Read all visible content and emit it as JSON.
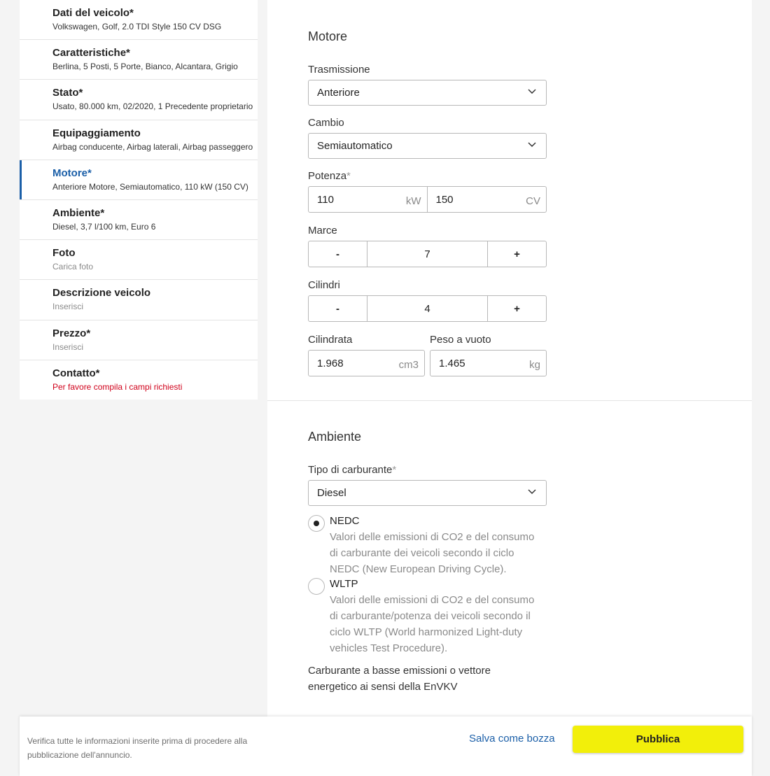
{
  "sidebar": {
    "items": [
      {
        "title": "Dati del veicolo*",
        "sub": "Volkswagen, Golf, 2.0 TDI Style 150 CV DSG"
      },
      {
        "title": "Caratteristiche*",
        "sub": "Berlina, 5 Posti, 5 Porte, Bianco, Alcantara, Grigio"
      },
      {
        "title": "Stato*",
        "sub": "Usato, 80.000 km, 02/2020, 1 Precedente proprietario"
      },
      {
        "title": "Equipaggiamento",
        "sub": "Airbag conducente, Airbag laterali, Airbag passeggero"
      },
      {
        "title": "Motore*",
        "sub": "Anteriore Motore, Semiautomatico, 110 kW (150 CV)"
      },
      {
        "title": "Ambiente*",
        "sub": "Diesel, 3,7 l/100 km, Euro 6"
      },
      {
        "title": "Foto",
        "sub": "Carica foto"
      },
      {
        "title": "Descrizione veicolo",
        "sub": "Inserisci"
      },
      {
        "title": "Prezzo*",
        "sub": "Inserisci"
      },
      {
        "title": "Contatto*",
        "sub": "Per favore compila i campi richiesti"
      }
    ]
  },
  "motore": {
    "title": "Motore",
    "trasmissione_label": "Trasmissione",
    "trasmissione_value": "Anteriore",
    "cambio_label": "Cambio",
    "cambio_value": "Semiautomatico",
    "potenza_label": "Potenza",
    "required_mark": "*",
    "potenza_kw": "110",
    "potenza_kw_unit": "kW",
    "potenza_cv": "150",
    "potenza_cv_unit": "CV",
    "marce_label": "Marce",
    "marce_value": "7",
    "cilindri_label": "Cilindri",
    "cilindri_value": "4",
    "minus": "-",
    "plus": "+",
    "cilindrata_label": "Cilindrata",
    "cilindrata_value": "1.968",
    "cilindrata_unit": "cm3",
    "peso_label": "Peso a vuoto",
    "peso_value": "1.465",
    "peso_unit": "kg"
  },
  "ambiente": {
    "title": "Ambiente",
    "carburante_label": "Tipo di carburante",
    "required_mark": "*",
    "carburante_value": "Diesel",
    "nedc_label": "NEDC",
    "nedc_desc": "Valori delle emissioni di CO2 e del consumo di carburante dei veicoli secondo il ciclo NEDC (New European Driving Cycle).",
    "wltp_label": "WLTP",
    "wltp_desc": "Valori delle emissioni di CO2 e del consumo di carburante/potenza dei veicoli secondo il ciclo WLTP (World harmonized Light-duty vehicles Test Procedure).",
    "basse_emissioni_label": "Carburante a basse emissioni o vettore energetico ai sensi della EnVKV"
  },
  "footer": {
    "note": "Verifica tutte le informazioni inserite prima di procedere alla pubblicazione dell'annuncio.",
    "draft_label": "Salva come bozza",
    "publish_label": "Pubblica"
  },
  "colors": {
    "accent": "#1b5fa8",
    "publish": "#f2ef0a",
    "error": "#d0021b"
  }
}
